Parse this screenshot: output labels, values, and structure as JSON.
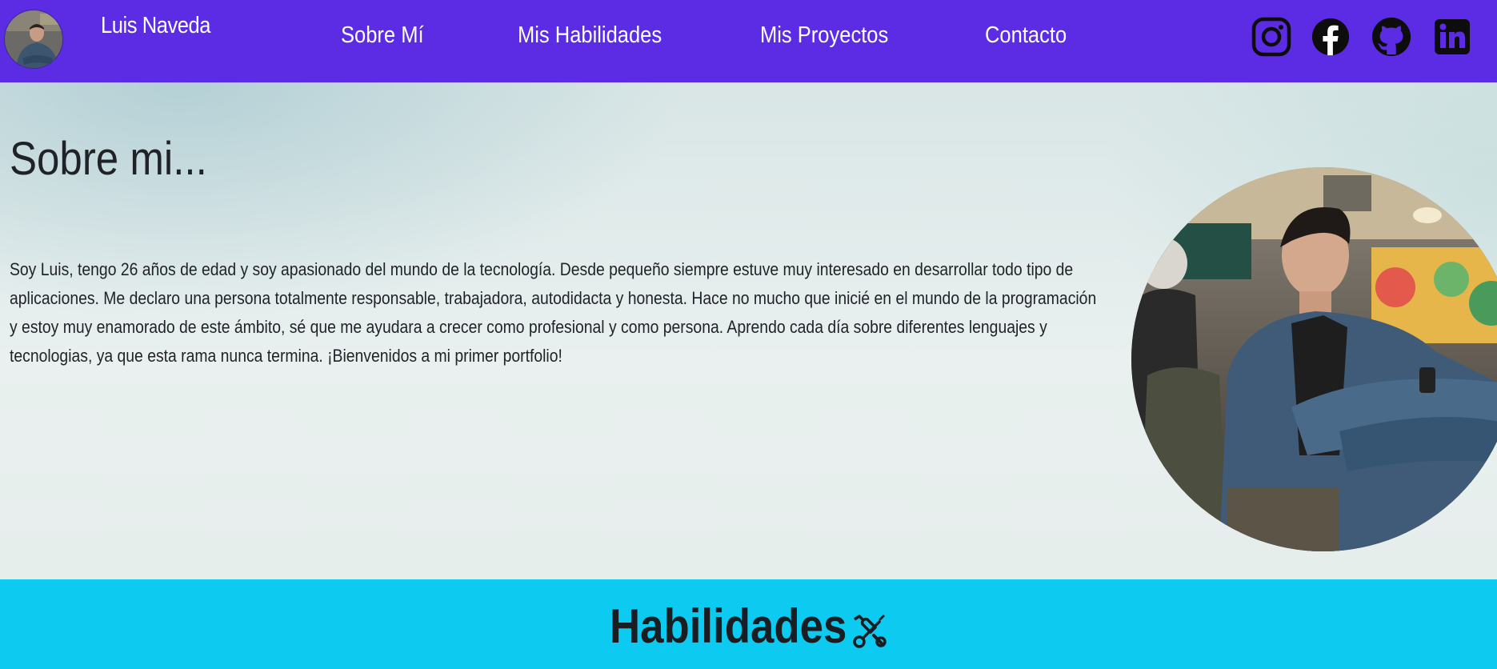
{
  "navbar": {
    "brand": "Luis Naveda",
    "links": [
      {
        "label": "Sobre Mí"
      },
      {
        "label": "Mis Habilidades"
      },
      {
        "label": "Mis Proyectos"
      },
      {
        "label": "Contacto"
      }
    ],
    "social_icons": [
      "instagram-icon",
      "facebook-icon",
      "github-icon",
      "linkedin-icon"
    ],
    "background_color": "#5c2ce4"
  },
  "hero": {
    "title": "Sobre mi...",
    "text": "Soy Luis, tengo 26 años de edad y soy apasionado del mundo de la tecnología. Desde pequeño siempre estuve muy interesado en desarrollar todo tipo de aplicaciones. Me declaro una persona totalmente responsable, trabajadora, autodidacta y honesta. Hace no mucho que inicié en el mundo de la programación y estoy muy enamorado de este ámbito, sé que me ayudara a crecer como profesional y como persona. Aprendo cada día sobre diferentes lenguajes y tecnologias, ya que esta rama nunca termina. ¡Bienvenidos a mi primer portfolio!"
  },
  "skills": {
    "title": "Habilidades",
    "icon": "tools-icon",
    "background_color": "#0dcaf0"
  }
}
